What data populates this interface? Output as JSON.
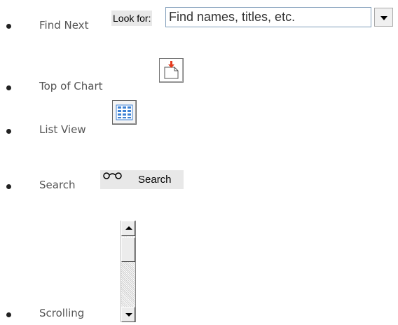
{
  "items": [
    {
      "label": "Find Next"
    },
    {
      "label": "Top of Chart"
    },
    {
      "label": "List View"
    },
    {
      "label": "Search"
    },
    {
      "label": "Scrolling"
    }
  ],
  "lookfor": {
    "caption": "Look for:",
    "value": "Find names, titles, etc."
  },
  "search_button": {
    "glyph": "º°º",
    "label": "Search"
  },
  "icons": {
    "top_of_chart": "page-with-red-down-arrow-icon",
    "list_view": "grid-list-icon",
    "search": "binoculars-icon",
    "dropdown": "triangle-down-icon"
  },
  "colors": {
    "text": "#555555",
    "arrow_red": "#e53b1e",
    "grid_blue": "#3e82d4"
  }
}
